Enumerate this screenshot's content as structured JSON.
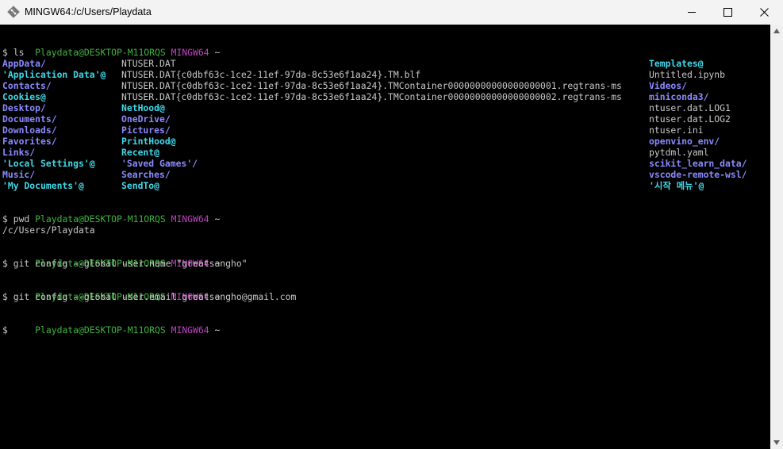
{
  "window": {
    "title": "MINGW64:/c/Users/Playdata",
    "icon": "git-bash-icon",
    "buttons": {
      "minimize": "minimize-icon",
      "maximize": "maximize-icon",
      "close": "close-icon"
    }
  },
  "colors": {
    "titlebar_bg": "#f3f3f3",
    "terminal_bg": "#000000",
    "prompt_user": "#3fb43f",
    "prompt_host": "#c040c0",
    "directory": "#8a8aff",
    "symlink": "#3fd8e8",
    "text": "#c8c8c8"
  },
  "prompt": {
    "user": "Playdata@DESKTOP-M11ORQS",
    "shell": "MINGW64",
    "path": "~"
  },
  "commands": {
    "ls": "$ ls",
    "pwd": "$ pwd",
    "pwd_output": "/c/Users/Playdata",
    "git_name": "$ git config --global user.name \"greatsangho\"",
    "git_email": "$ git config --global user.email greatsangho@gmail.com",
    "cursor": "$"
  },
  "ls_output": [
    [
      {
        "text": "AppData/",
        "type": "d"
      },
      {
        "text": "NTUSER.DAT",
        "type": "f"
      },
      {
        "text": "Templates@",
        "type": "l"
      }
    ],
    [
      {
        "text": "'Application Data'@",
        "type": "l"
      },
      {
        "text": "NTUSER.DAT{c0dbf63c-1ce2-11ef-97da-8c53e6f1aa24}.TM.blf",
        "type": "f"
      },
      {
        "text": "Untitled.ipynb",
        "type": "f"
      }
    ],
    [
      {
        "text": "Contacts/",
        "type": "d"
      },
      {
        "text": "NTUSER.DAT{c0dbf63c-1ce2-11ef-97da-8c53e6f1aa24}.TMContainer00000000000000000001.regtrans-ms",
        "type": "f"
      },
      {
        "text": "Videos/",
        "type": "d"
      }
    ],
    [
      {
        "text": "Cookies@",
        "type": "l"
      },
      {
        "text": "NTUSER.DAT{c0dbf63c-1ce2-11ef-97da-8c53e6f1aa24}.TMContainer00000000000000000002.regtrans-ms",
        "type": "f"
      },
      {
        "text": "miniconda3/",
        "type": "d"
      }
    ],
    [
      {
        "text": "Desktop/",
        "type": "d"
      },
      {
        "text": "NetHood@",
        "type": "l"
      },
      {
        "text": "ntuser.dat.LOG1",
        "type": "f"
      }
    ],
    [
      {
        "text": "Documents/",
        "type": "d"
      },
      {
        "text": "OneDrive/",
        "type": "d"
      },
      {
        "text": "ntuser.dat.LOG2",
        "type": "f"
      }
    ],
    [
      {
        "text": "Downloads/",
        "type": "d"
      },
      {
        "text": "Pictures/",
        "type": "d"
      },
      {
        "text": "ntuser.ini",
        "type": "f"
      }
    ],
    [
      {
        "text": "Favorites/",
        "type": "d"
      },
      {
        "text": "PrintHood@",
        "type": "l"
      },
      {
        "text": "openvino_env/",
        "type": "d"
      }
    ],
    [
      {
        "text": "Links/",
        "type": "d"
      },
      {
        "text": "Recent@",
        "type": "l"
      },
      {
        "text": "pytdml.yaml",
        "type": "f"
      }
    ],
    [
      {
        "text": "'Local Settings'@",
        "type": "l"
      },
      {
        "text": "'Saved Games'/",
        "type": "d"
      },
      {
        "text": "scikit_learn_data/",
        "type": "d"
      }
    ],
    [
      {
        "text": "Music/",
        "type": "d"
      },
      {
        "text": "Searches/",
        "type": "d"
      },
      {
        "text": "vscode-remote-wsl/",
        "type": "d"
      }
    ],
    [
      {
        "text": "'My Documents'@",
        "type": "l"
      },
      {
        "text": "SendTo@",
        "type": "l"
      },
      {
        "text": "'시작 메뉴'@",
        "type": "l"
      }
    ]
  ]
}
